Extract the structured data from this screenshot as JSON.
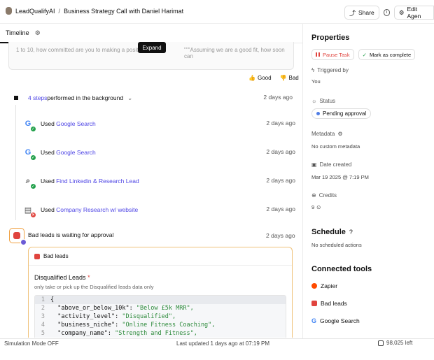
{
  "header": {
    "app_name": "LeadQualifyAI",
    "separator": "/",
    "page_title": "Business Strategy Call with Daniel Harimat",
    "share_label": "Share",
    "edit_label": "Edit Agen"
  },
  "tabs": {
    "timeline": "Timeline"
  },
  "message": {
    "text": "1 to 10, how committed are you to making a positi",
    "text_right": "\"\"\"Assuming we are a good fit, how soon can",
    "expand_label": "Expand",
    "good_label": "Good",
    "bad_label": "Bad"
  },
  "background": {
    "steps_link": "4 steps",
    "steps_text": " performed in the background",
    "time": "2 days ago"
  },
  "steps": [
    {
      "prefix": "Used",
      "tool": "Google Search",
      "time": "2 days ago",
      "icon": "google-icon",
      "status": "success"
    },
    {
      "prefix": "Used",
      "tool": "Google Search",
      "time": "2 days ago",
      "icon": "google-icon",
      "status": "success"
    },
    {
      "prefix": "Used",
      "tool": "Find Linkedin & Research Lead",
      "time": "2 days ago",
      "icon": "magnifier-icon",
      "status": "success"
    },
    {
      "prefix": "Used",
      "tool": "Company Research w/ website",
      "time": "2 days ago",
      "icon": "browser-icon",
      "status": "error"
    }
  ],
  "approval": {
    "title": "Bad leads is waiting for approval",
    "time": "2 days ago",
    "card_title": "Bad leads",
    "field_label": "Disqualified Leads",
    "required_mark": "*",
    "field_hint": "only take or pick up the Disqualified leads data only",
    "code_lines": [
      {
        "n": "1",
        "key": "{",
        "val": ""
      },
      {
        "n": "2",
        "key": "  \"above_or_below_10k\": ",
        "val": "\"Below £5k MRR\","
      },
      {
        "n": "3",
        "key": "  \"activity_level\": ",
        "val": "\"Disqualified\","
      },
      {
        "n": "4",
        "key": "  \"business_niche\": ",
        "val": "\"Online Fitness Coaching\","
      },
      {
        "n": "5",
        "key": "  \"company_name\": ",
        "val": "\"Strength and Fitness\","
      }
    ]
  },
  "properties": {
    "title": "Properties",
    "pause_label": "Pause Task",
    "complete_label": "Mark as complete",
    "triggered_label": "Triggered by",
    "triggered_value": "You",
    "status_label": "Status",
    "status_value": "Pending approval",
    "metadata_label": "Metadata",
    "metadata_value": "No custom metadata",
    "date_label": "Date created",
    "date_value": "Mar 19 2025 @ 7:19 PM",
    "credits_label": "Credits",
    "credits_value": "9"
  },
  "schedule": {
    "title": "Schedule",
    "value": "No scheduled actions"
  },
  "tools": {
    "title": "Connected tools",
    "items": [
      {
        "name": "Zapier",
        "icon": "zapier-icon",
        "color": "#ff4a00"
      },
      {
        "name": "Bad leads",
        "icon": "bad-leads-icon",
        "color": "#e0443e"
      },
      {
        "name": "Google Search",
        "icon": "google-icon",
        "color": "#4285f4"
      }
    ]
  },
  "footer": {
    "sim_mode": "Simulation Mode OFF",
    "updated": "Last updated 1 days ago at 07:19 PM",
    "credits_left": "98,025 left"
  },
  "colors": {
    "accent": "#4f46e5",
    "warning_border": "#f0c27a",
    "success": "#22a04b",
    "error": "#e0443e",
    "pause": "#e0443e"
  }
}
